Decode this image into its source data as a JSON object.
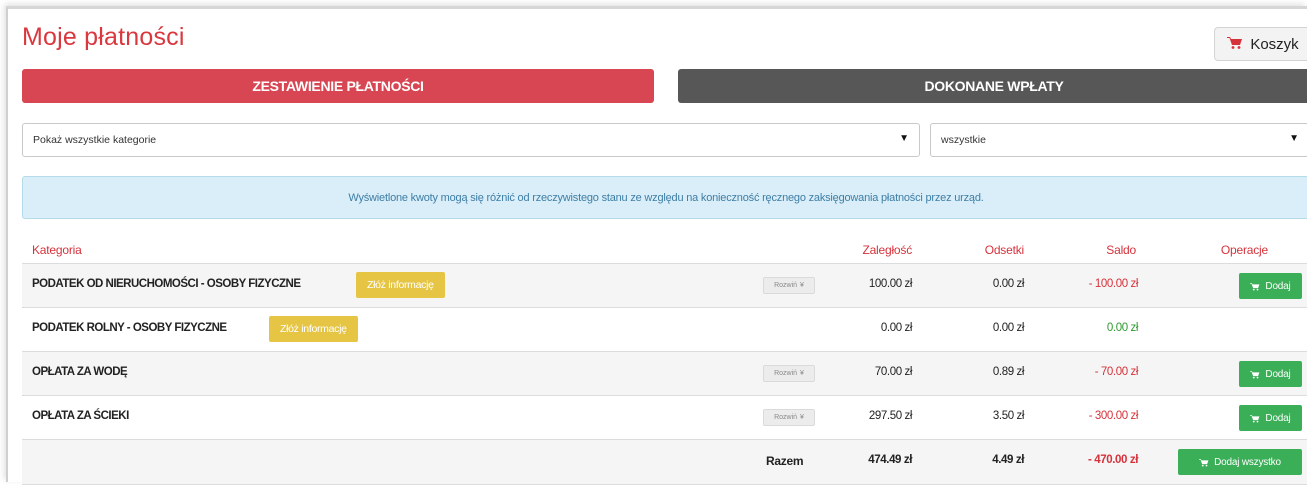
{
  "page": {
    "title": "Moje płatności",
    "cart_label": "Koszyk"
  },
  "tabs": [
    {
      "label": "ZESTAWIENIE PŁATNOŚCI",
      "active": true
    },
    {
      "label": "DOKONANE WPŁATY",
      "active": false
    }
  ],
  "filters": {
    "category": "Pokaż wszystkie kategorie",
    "status": "wszystkie"
  },
  "info_message": "Wyświetlone kwoty mogą się różnić od rzeczywistego stanu ze względu na konieczność ręcznego zaksięgowania płatności przez urząd.",
  "table": {
    "headers": {
      "category": "Kategoria",
      "arrears": "Zaległość",
      "interest": "Odsetki",
      "balance": "Saldo",
      "operations": "Operacje"
    },
    "rows": [
      {
        "name": "PODATEK OD NIERUCHOMOŚCI - OSOBY FIZYCZNE",
        "info_button": "Złóż informację",
        "expand_label": "Rozwiń",
        "arrears": "100.00 zł",
        "interest": "0.00 zł",
        "balance": "- 100.00 zł",
        "add_label": "Dodaj"
      },
      {
        "name": "PODATEK ROLNY - OSOBY FIZYCZNE",
        "info_button": "Złóż informację",
        "expand_label": "",
        "arrears": "0.00 zł",
        "interest": "0.00 zł",
        "balance": "0.00 zł",
        "add_label": ""
      },
      {
        "name": "OPŁATA ZA WODĘ",
        "info_button": "",
        "expand_label": "Rozwiń",
        "arrears": "70.00 zł",
        "interest": "0.89 zł",
        "balance": "- 70.00 zł",
        "add_label": "Dodaj"
      },
      {
        "name": "OPŁATA ZA ŚCIEKI",
        "info_button": "",
        "expand_label": "Rozwiń",
        "arrears": "297.50 zł",
        "interest": "3.50 zł",
        "balance": "- 300.00 zł",
        "add_label": "Dodaj"
      }
    ],
    "total": {
      "label": "Razem",
      "arrears": "474.49 zł",
      "interest": "4.49 zł",
      "balance": "- 470.00 zł",
      "add_all_label": "Dodaj wszystko"
    }
  },
  "colors": {
    "accent_red": "#d74652",
    "dark_tab": "#575757",
    "success_green": "#3bae58",
    "warning_yellow": "#e6c545",
    "info_bg": "#d9eef8"
  },
  "icons": {
    "cart": "cart-icon",
    "chevron": "double-chevron-down-icon",
    "dropdown": "caret-down-icon"
  }
}
